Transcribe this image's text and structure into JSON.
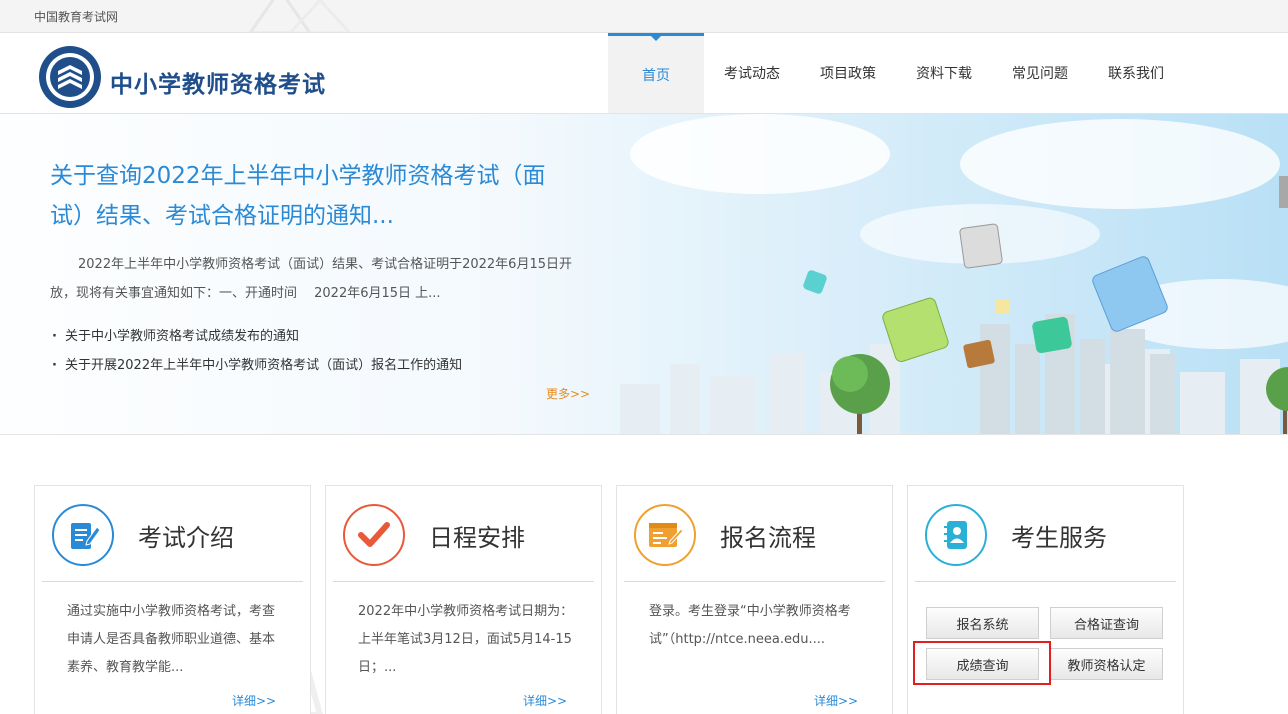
{
  "topbar": {
    "site_link": "中国教育考试网"
  },
  "header": {
    "title": "中小学教师资格考试",
    "nav": [
      {
        "label": "首页",
        "active": true
      },
      {
        "label": "考试动态"
      },
      {
        "label": "项目政策"
      },
      {
        "label": "资料下载"
      },
      {
        "label": "常见问题"
      },
      {
        "label": "联系我们"
      }
    ]
  },
  "banner": {
    "headline": "关于查询2022年上半年中小学教师资格考试（面试）结果、考试合格证明的通知...",
    "summary": "2022年上半年中小学教师资格考试（面试）结果、考试合格证明于2022年6月15日开放，现将有关事宜通知如下：一、开通时间　 2022年6月15日 上...",
    "news": [
      "关于中小学教师资格考试成绩发布的通知",
      "关于开展2022年上半年中小学教师资格考试（面试）报名工作的通知"
    ],
    "more": "更多>>"
  },
  "cards": [
    {
      "title": "考试介绍",
      "icon": "document-edit-icon",
      "color": "#2a8ad6",
      "body": "通过实施中小学教师资格考试，考查申请人是否具备教师职业道德、基本素养、教育教学能...",
      "more": "详细>>"
    },
    {
      "title": "日程安排",
      "icon": "checkmark-icon",
      "color": "#e8593a",
      "body": "2022年中小学教师资格考试日期为：上半年笔试3月12日，面试5月14-15日；...",
      "more": "详细>>"
    },
    {
      "title": "报名流程",
      "icon": "form-edit-icon",
      "color": "#f0a030",
      "body": "登录。考生登录“中小学教师资格考试”（http://ntce.neea.edu....",
      "more": "详细>>"
    },
    {
      "title": "考生服务",
      "icon": "contact-book-icon",
      "color": "#2ab0d6",
      "buttons": [
        "报名系统",
        "合格证查询",
        "成绩查询",
        "教师资格认定"
      ]
    }
  ]
}
